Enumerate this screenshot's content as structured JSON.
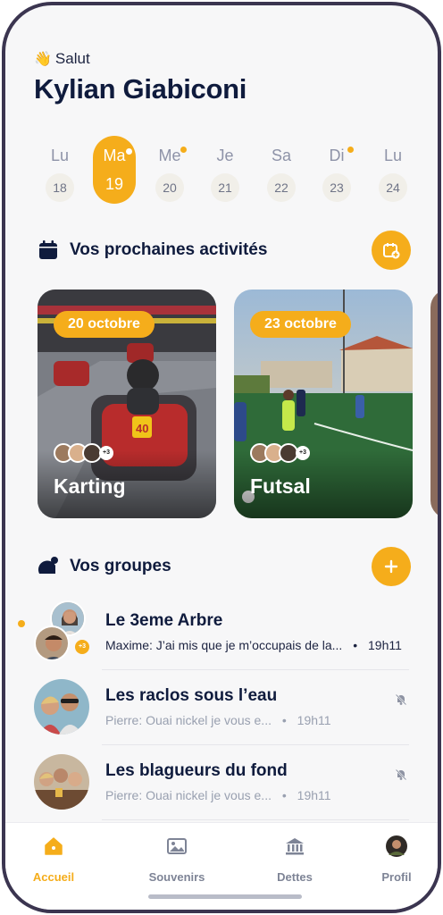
{
  "header": {
    "greeting_emoji": "👋",
    "greeting": "Salut",
    "user_name": "Kylian Giabiconi"
  },
  "calendar": {
    "days": [
      {
        "label": "Lu",
        "num": "18",
        "active": false,
        "dot": false
      },
      {
        "label": "Ma",
        "num": "19",
        "active": true,
        "dot": true
      },
      {
        "label": "Me",
        "num": "20",
        "active": false,
        "dot": true
      },
      {
        "label": "Je",
        "num": "21",
        "active": false,
        "dot": false
      },
      {
        "label": "Sa",
        "num": "22",
        "active": false,
        "dot": false
      },
      {
        "label": "Di",
        "num": "23",
        "active": false,
        "dot": true
      },
      {
        "label": "Lu",
        "num": "24",
        "active": false,
        "dot": false
      }
    ]
  },
  "activities": {
    "title": "Vos prochaines activités",
    "items": [
      {
        "date": "20 octobre",
        "title": "Karting",
        "extra": "+3"
      },
      {
        "date": "23 octobre",
        "title": "Futsal",
        "extra": "+3"
      }
    ]
  },
  "groups": {
    "title": "Vos groupes",
    "items": [
      {
        "name": "Le 3eme Arbre",
        "message": "Maxime: J’ai mis que je m’occupais de la...",
        "time": "19h11",
        "unread": true,
        "muted": false,
        "extra": "+3"
      },
      {
        "name": "Les raclos sous l’eau",
        "message": "Pierre: Ouai nickel je vous e...",
        "time": "19h11",
        "unread": false,
        "muted": true
      },
      {
        "name": "Les blagueurs du fond",
        "message": "Pierre: Ouai nickel je vous e...",
        "time": "19h11",
        "unread": false,
        "muted": true
      }
    ]
  },
  "tabbar": {
    "tabs": [
      {
        "label": "Accueil",
        "icon": "home-icon",
        "active": true
      },
      {
        "label": "Souvenirs",
        "icon": "image-icon",
        "active": false
      },
      {
        "label": "Dettes",
        "icon": "bank-icon",
        "active": false
      },
      {
        "label": "Profil",
        "icon": "avatar",
        "active": false
      }
    ]
  },
  "colors": {
    "accent": "#f5ad1b",
    "text_dark": "#0f1b3d",
    "muted": "#99a0b0"
  }
}
